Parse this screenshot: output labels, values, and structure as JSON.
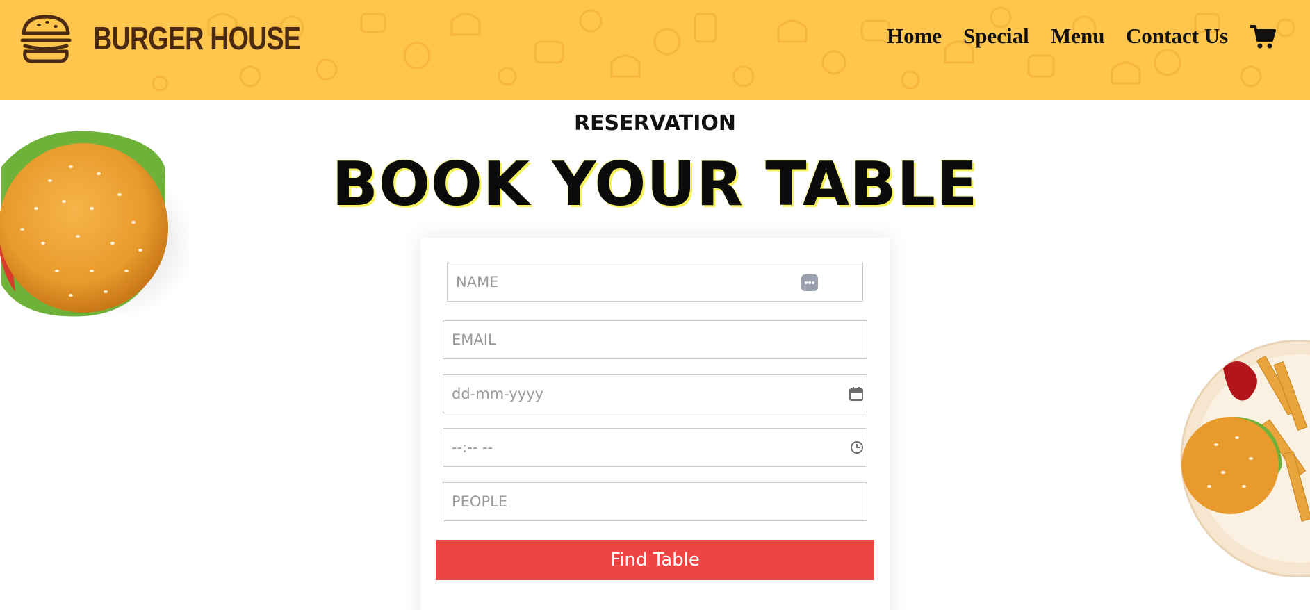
{
  "brand": {
    "name": "BURGER HOUSE",
    "logo_icon": "burger-logo-icon"
  },
  "nav": {
    "items": [
      {
        "label": "Home"
      },
      {
        "label": "Special"
      },
      {
        "label": "Menu"
      },
      {
        "label": "Contact Us"
      }
    ],
    "cart_icon": "cart-icon"
  },
  "section": {
    "eyebrow": "RESERVATION",
    "title": "BOOK YOUR TABLE"
  },
  "form": {
    "name_placeholder": "NAME",
    "email_placeholder": "EMAIL",
    "date_placeholder": "dd-mm-yyyy",
    "time_placeholder": "--:-- --",
    "people_placeholder": "PEOPLE",
    "submit_label": "Find Table"
  },
  "colors": {
    "header_bg": "#ffc54d",
    "brand_text": "#4a2a12",
    "button_bg": "#ef4444",
    "title_glow": "#f5f25a"
  }
}
